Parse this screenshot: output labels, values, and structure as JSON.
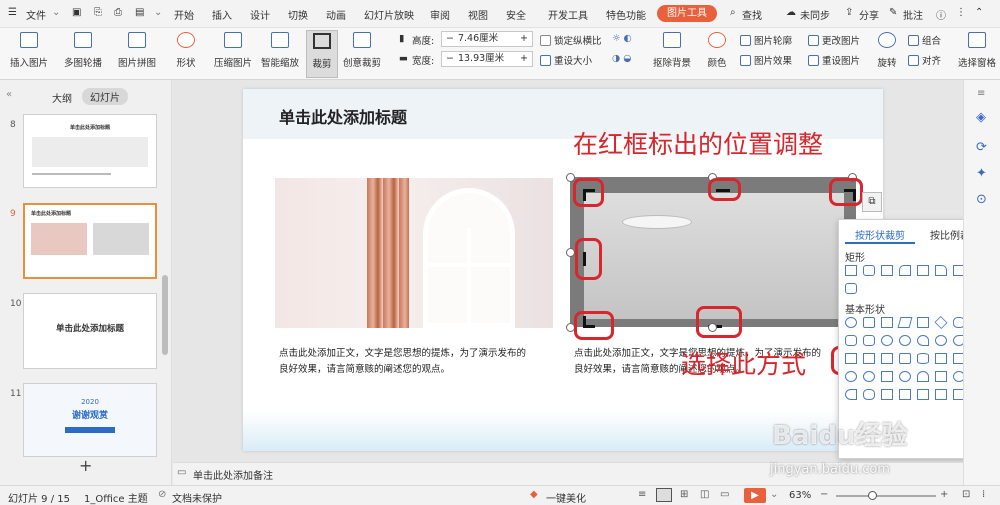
{
  "menubar": {
    "file": "文件",
    "tabs": [
      "开始",
      "插入",
      "设计",
      "切换",
      "动画",
      "幻灯片放映",
      "审阅",
      "视图",
      "安全",
      "开发工具",
      "特色功能"
    ],
    "active_tab": "图片工具",
    "search": "查找",
    "sync": "未同步",
    "share": "分享",
    "comment": "批注"
  },
  "ribbon": {
    "insert_pic": "插入图片",
    "multi_pic": "多图轮播",
    "pic_collage": "图片拼图",
    "shape": "形状",
    "compress": "压缩图片",
    "smart_zoom": "智能缩放",
    "crop": "裁剪",
    "creative_crop": "创意裁剪",
    "height_label": "高度:",
    "height_value": "7.46厘米",
    "width_label": "宽度:",
    "width_value": "13.93厘米",
    "lock_ratio": "锁定纵横比",
    "resize": "重设大小",
    "remove_bg": "抠除背景",
    "color": "颜色",
    "pic_outline": "图片轮廓",
    "pic_effect": "图片效果",
    "change_pic": "更改图片",
    "reset_pic": "重设图片",
    "rotate": "旋转",
    "group": "组合",
    "align": "对齐",
    "select_pane": "选择窗格"
  },
  "panel": {
    "tab_outline": "大纲",
    "tab_slides": "幻灯片",
    "slides": [
      {
        "num": "8",
        "title": "单击此处添加标题"
      },
      {
        "num": "9",
        "title": "单击此处添加标题"
      },
      {
        "num": "10",
        "title": "单击此处添加标题"
      },
      {
        "num": "11",
        "year": "2020",
        "title": "谢谢观赏"
      }
    ]
  },
  "slide": {
    "title": "单击此处添加标题",
    "body_left_line1": "点击此处添加正文，文字是您思想的提炼，为了演示发布的",
    "body_left_line2": "良好效果，请言简意赅的阐述您的观点。",
    "body_right_line1": "点击此处添加正文，文字是您思想的提炼，为了演示发布的",
    "body_right_line2": "良好效果，请言简意赅的阐述您的观点。",
    "annotation_top": "在红框标出的位置调整",
    "annotation_bottom": "选择此方式"
  },
  "crop_popup": {
    "tab_shape": "按形状裁剪",
    "tab_ratio": "按比例裁剪",
    "section_rect": "矩形",
    "section_basic": "基本形状"
  },
  "notes": {
    "placeholder": "单击此处添加备注"
  },
  "status": {
    "slide_count": "幻灯片 9 / 15",
    "theme": "1_Office 主题",
    "protect": "文档未保护",
    "beautify": "一键美化",
    "zoom": "63%"
  },
  "watermark": {
    "brand": "Baidu经验",
    "url": "jingyan.baidu.com"
  },
  "colors": {
    "accent": "#e8603c",
    "red": "#d7262c",
    "blue": "#2b6cc4"
  }
}
